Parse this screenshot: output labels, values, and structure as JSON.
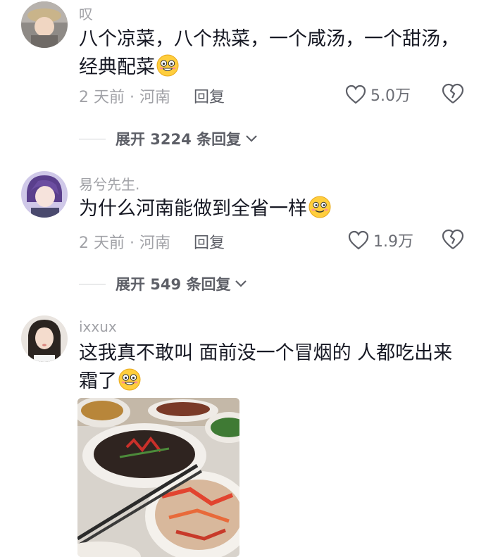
{
  "comments": [
    {
      "username": "叹",
      "text": "八个凉菜，八个热菜，一个咸汤，一个甜汤，经典配菜",
      "time_location": "2 天前 · 河南",
      "reply_label": "回复",
      "likes": "5.0万",
      "expand_label": "展开 3224 条回复"
    },
    {
      "username": "易兮先生.",
      "text": "为什么河南能做到全省一样",
      "time_location": "2 天前 · 河南",
      "reply_label": "回复",
      "likes": "1.9万",
      "expand_label": "展开 549 条回复"
    },
    {
      "username": "ixxux",
      "text": "这我真不敢叫 面前没一个冒烟的 人都吃出来霜了",
      "has_image": true
    }
  ],
  "colors": {
    "primary_text": "#161823",
    "secondary_text": "#a1a2a7",
    "action_text": "#5d5f67"
  }
}
